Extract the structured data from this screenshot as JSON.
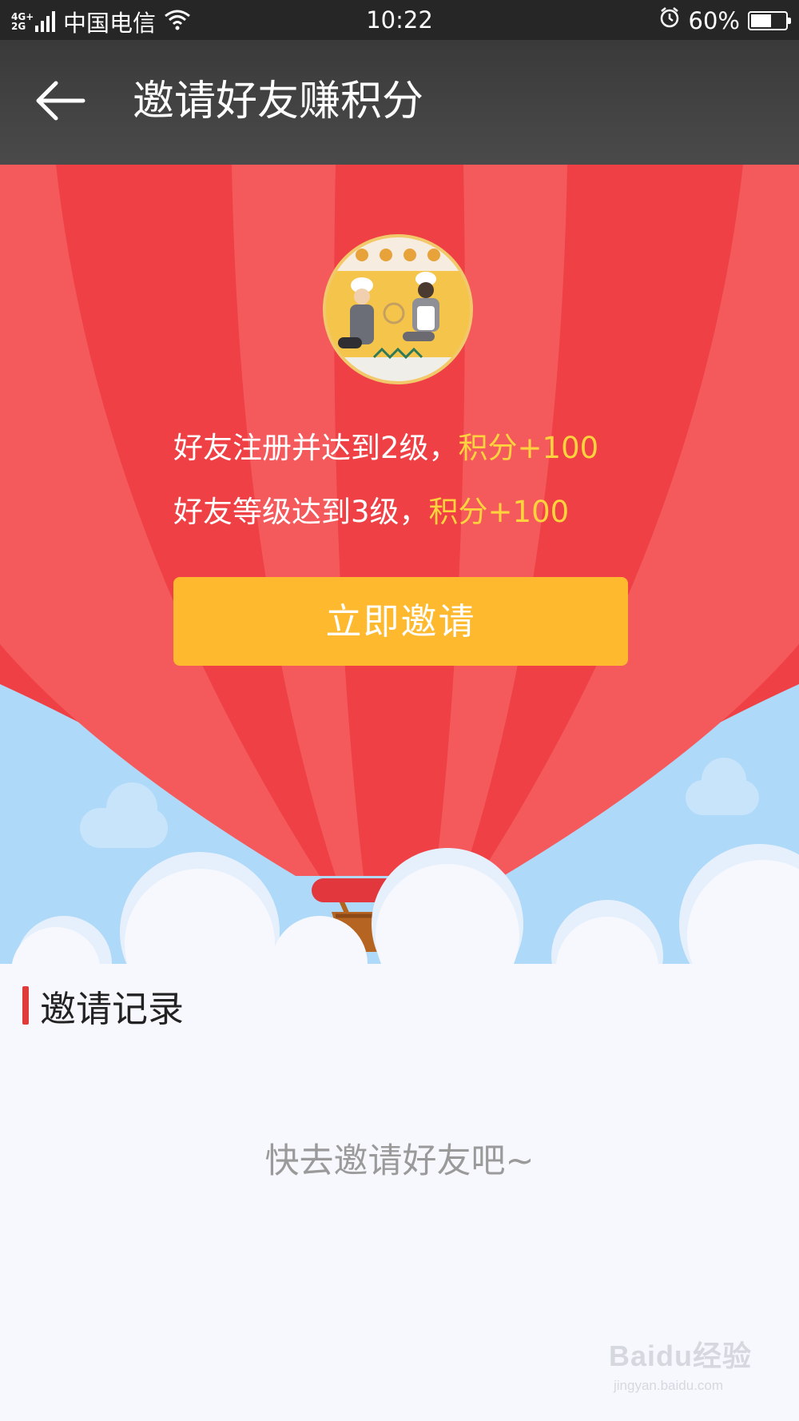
{
  "status_bar": {
    "network_type": "4G+\n2G",
    "carrier": "中国电信",
    "time": "10:22",
    "battery_percent": "60%",
    "battery_level": 0.6,
    "icons": [
      "signal-icon",
      "wifi-icon",
      "alarm-icon",
      "battery-icon"
    ]
  },
  "app_bar": {
    "title": "邀请好友赚积分",
    "back_icon": "arrow-left-icon"
  },
  "invite": {
    "rule_1_text": "好友注册并达到2级，",
    "rule_1_reward": "积分+100",
    "rule_2_text": "好友等级达到3级，",
    "rule_2_reward": "积分+100",
    "button_label": "立即邀请"
  },
  "records": {
    "title": "邀请记录",
    "empty_message": "快去邀请好友吧~"
  },
  "watermark": {
    "logo": "Baidu经验",
    "url": "jingyan.baidu.com"
  },
  "colors": {
    "status_bar_bg": "#262626",
    "app_bar_bg": "#424242",
    "balloon_red": "#ef4045",
    "balloon_light": "#f45a5c",
    "sky": "#aed9f9",
    "highlight": "#ffd33d",
    "button": "#ffb92e",
    "accent": "#e03b3b"
  }
}
